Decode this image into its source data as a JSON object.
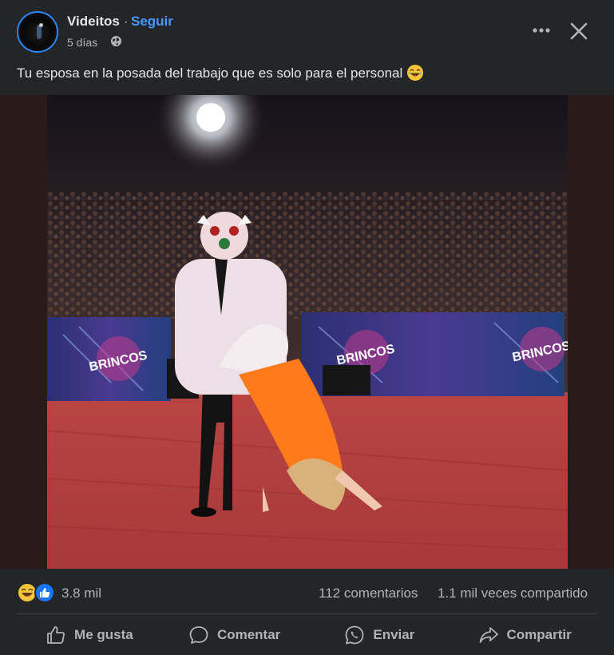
{
  "post": {
    "page_name": "Videitos",
    "separator": "·",
    "follow_label": "Seguir",
    "time": "5 días",
    "caption": "Tu esposa en la posada del trabajo que es solo para el personal",
    "caption_emoji": "laughing-emoji",
    "media_text": [
      "BRINCOS",
      "BRINCOS",
      "BRINCOS"
    ]
  },
  "stats": {
    "reactions": "3.8 mil",
    "comments": "112 comentarios",
    "shares": "1.1 mil veces compartido"
  },
  "actions": {
    "like": "Me gusta",
    "comment": "Comentar",
    "send": "Enviar",
    "share": "Compartir"
  },
  "colors": {
    "accent": "#4599ff",
    "background": "#242526",
    "like_blue": "#1877f2",
    "haha_yellow": "#f7c53a"
  }
}
